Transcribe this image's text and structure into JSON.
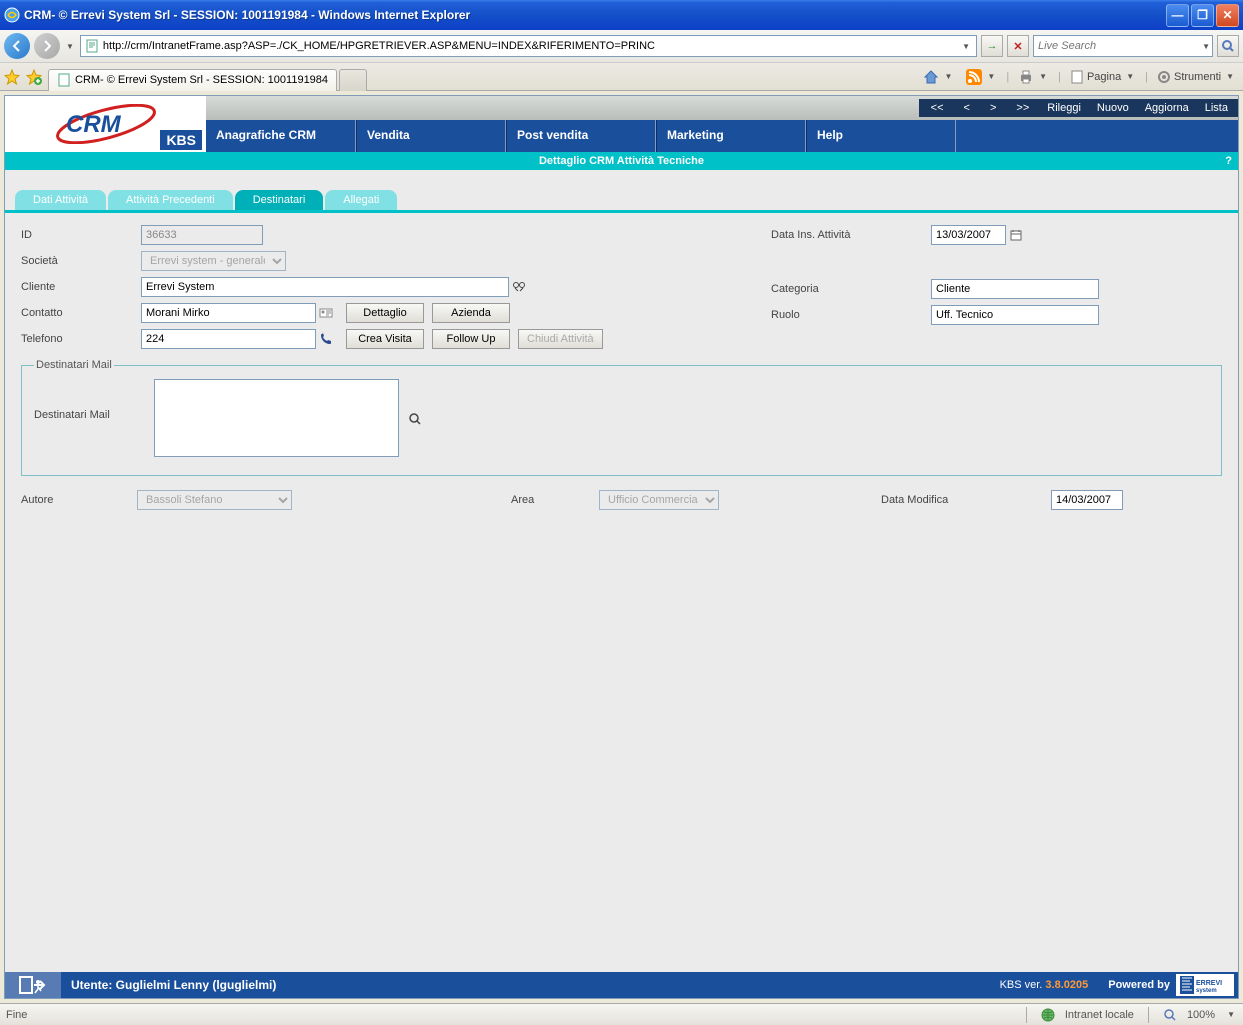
{
  "window": {
    "title": "CRM- © Errevi System Srl - SESSION: 1001191984 - Windows Internet Explorer"
  },
  "browser": {
    "url": "http://crm/IntranetFrame.asp?ASP=./CK_HOME/HPGRETRIEVER.ASP&MENU=INDEX&RIFERIMENTO=PRINC",
    "search_placeholder": "Live Search",
    "tab_title": "CRM- © Errevi System Srl - SESSION: 1001191984",
    "toolbar": {
      "pagina": "Pagina",
      "strumenti": "Strumenti"
    }
  },
  "app": {
    "logo": "CRM",
    "logo_sub": "KBS",
    "nav": {
      "first": "<<",
      "prev": "<",
      "next": ">",
      "last": ">>",
      "rileggi": "Rileggi",
      "nuovo": "Nuovo",
      "aggiorna": "Aggiorna",
      "lista": "Lista"
    },
    "menu": {
      "anagrafiche": "Anagrafiche CRM",
      "vendita": "Vendita",
      "postvendita": "Post vendita",
      "marketing": "Marketing",
      "help": "Help"
    },
    "subheader": "Dettaglio CRM Attività Tecniche",
    "subheader_help": "?"
  },
  "tabs": {
    "dati": "Dati Attività",
    "precedenti": "Attività Precedenti",
    "destinatari": "Destinatari",
    "allegati": "Allegati"
  },
  "form": {
    "labels": {
      "id": "ID",
      "societa": "Società",
      "cliente": "Cliente",
      "contatto": "Contatto",
      "telefono": "Telefono",
      "data_ins": "Data Ins. Attività",
      "categoria": "Categoria",
      "ruolo": "Ruolo",
      "dest_mail_legend": "Destinatari Mail",
      "dest_mail": "Destinatari Mail",
      "autore": "Autore",
      "area": "Area",
      "data_mod": "Data Modifica"
    },
    "values": {
      "id": "36633",
      "societa": "Errevi system - generale",
      "cliente": "Errevi System",
      "contatto": "Morani Mirko",
      "telefono": "224",
      "data_ins": "13/03/2007",
      "categoria": "Cliente",
      "ruolo": "Uff. Tecnico",
      "autore": "Bassoli Stefano",
      "area": "Ufficio Commerciale",
      "data_mod": "14/03/2007"
    },
    "buttons": {
      "dettaglio": "Dettaglio",
      "azienda": "Azienda",
      "crea_visita": "Crea Visita",
      "followup": "Follow Up",
      "chiudi": "Chiudi Attività"
    }
  },
  "footer": {
    "user_label": "Utente: Guglielmi Lenny (lguglielmi)",
    "ver_label": "KBS ver.",
    "ver": "3.8.0205",
    "powered": "Powered by",
    "errevi": "ERREVI system"
  },
  "status": {
    "left": "Fine",
    "zone": "Intranet locale",
    "zoom": "100%"
  }
}
